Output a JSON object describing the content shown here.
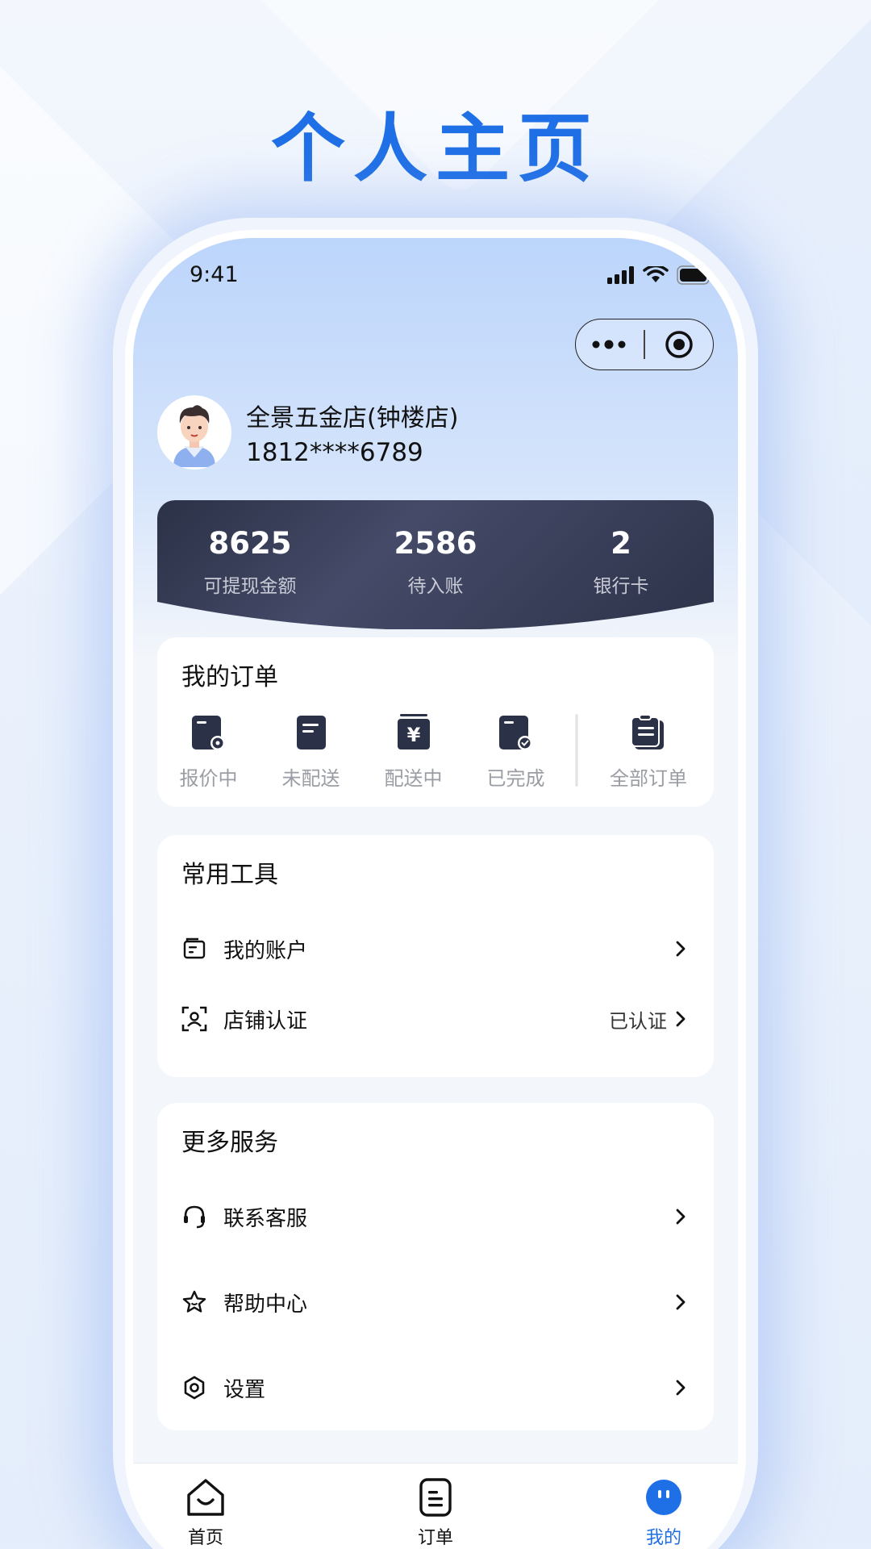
{
  "headline": "个人主页",
  "status_bar": {
    "time": "9:41"
  },
  "profile": {
    "name": "全景五金店(钟楼店)",
    "phone": "1812****6789"
  },
  "stats": [
    {
      "value": "8625",
      "label": "可提现金额"
    },
    {
      "value": "2586",
      "label": "待入账"
    },
    {
      "value": "2",
      "label": "银行卡"
    }
  ],
  "orders": {
    "title": "我的订单",
    "items": [
      {
        "label": "报价中",
        "icon": "quote-doc-icon"
      },
      {
        "label": "未配送",
        "icon": "doc-icon"
      },
      {
        "label": "配送中",
        "icon": "yen-doc-icon"
      },
      {
        "label": "已完成",
        "icon": "done-doc-icon"
      }
    ],
    "all_label": "全部订单"
  },
  "tools": {
    "title": "常用工具",
    "items": [
      {
        "label": "我的账户",
        "status": "",
        "icon": "wallet-icon"
      },
      {
        "label": "店铺认证",
        "status": "已认证",
        "icon": "face-scan-icon"
      }
    ]
  },
  "more": {
    "title": "更多服务",
    "items": [
      {
        "label": "联系客服",
        "icon": "headset-icon"
      },
      {
        "label": "帮助中心",
        "icon": "star-icon"
      },
      {
        "label": "设置",
        "icon": "settings-icon"
      }
    ]
  },
  "tabbar": {
    "items": [
      {
        "label": "首页",
        "icon": "home-icon",
        "active": false
      },
      {
        "label": "订单",
        "icon": "order-icon",
        "active": false
      },
      {
        "label": "我的",
        "icon": "profile-icon",
        "active": true
      }
    ],
    "active_color": "#1f6fe6"
  },
  "colors": {
    "accent": "#1f6fe6",
    "stats_card": "#2b3146"
  }
}
